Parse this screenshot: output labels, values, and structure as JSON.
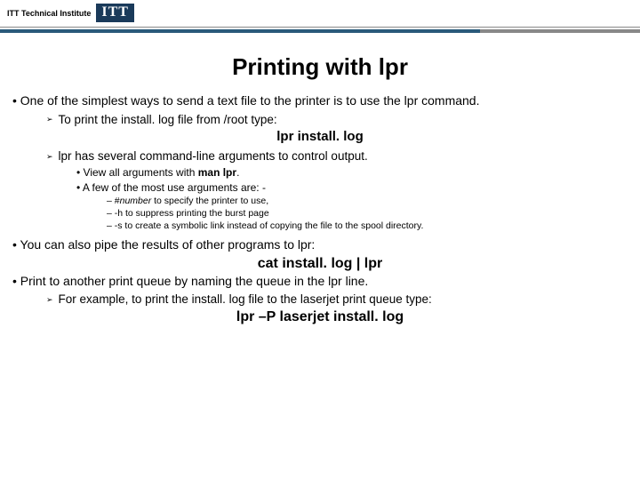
{
  "header": {
    "brand_text": "ITT Technical Institute",
    "logo_text": "ITT"
  },
  "slide": {
    "title": "Printing with lpr",
    "b1": "• One of the simplest ways to send a text file to the printer is to use the lpr command.",
    "b1_1": "To print the install. log file from /root type:",
    "cmd1": "lpr install. log",
    "b1_2": "lpr has several command-line arguments to control output.",
    "b1_2_1_pre": "•   View all arguments with ",
    "b1_2_1_bold": "man lpr",
    "b1_2_1_post": ".",
    "b1_2_2": "•   A few of the most use arguments are: -",
    "d1_pre": "–   #",
    "d1_it": "number",
    "d1_post": " to specify the printer to use,",
    "d2": "–   -h to suppress printing the burst page",
    "d3": "–   -s to create a symbolic link instead of copying the file to the spool directory.",
    "b2": "• You can also pipe the results of other programs to lpr:",
    "cmd2": "cat install. log | lpr",
    "b3": "• Print to another print queue by naming the queue in the lpr line.",
    "b3_1": "For example, to print the install. log file to the laserjet print queue type:",
    "cmd3": "lpr –P laserjet install. log",
    "arrow": "➢"
  }
}
